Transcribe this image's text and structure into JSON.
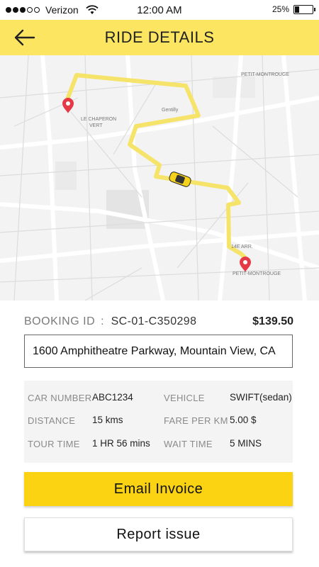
{
  "status_bar": {
    "carrier": "Verizon",
    "time": "12:00 AM",
    "battery_text": "25%",
    "battery_level": 0.25,
    "signal_bars_filled": 3,
    "signal_bars_total": 5
  },
  "header": {
    "title": "RIDE DETAILS",
    "background": "#fbe561"
  },
  "map": {
    "route_color": "#f5e36a",
    "pin_color": "#e53945",
    "labels": {
      "chaperon": "LE CHAPERON",
      "vert": "VERT",
      "gentilly": "Gentilly",
      "petit_top": "PETIT-MONTROUGE",
      "petit_bottom": "PETIT-MONTROUGE",
      "arr": "14E ARR."
    }
  },
  "booking": {
    "label": "BOOKING ID",
    "separator": ":",
    "id": "SC-01-C350298",
    "amount": "$139.50"
  },
  "address": "1600 Amphitheatre Parkway, Mountain View, CA",
  "details": {
    "car_number_label": "CAR NUMBER",
    "car_number": "ABC1234",
    "vehicle_label": "VEHICLE",
    "vehicle": "SWIFT(sedan)",
    "distance_label": "DISTANCE",
    "distance": "15 kms",
    "fare_label": "FARE PER KM",
    "fare": "5.00 $",
    "tour_time_label": "TOUR TIME",
    "tour_time": "1 HR 56 mins",
    "wait_time_label": "WAIT TIME",
    "wait_time": "5 MINS"
  },
  "actions": {
    "email_invoice": "Email Invoice",
    "report_issue": "Report issue",
    "accent": "#fbd313"
  }
}
